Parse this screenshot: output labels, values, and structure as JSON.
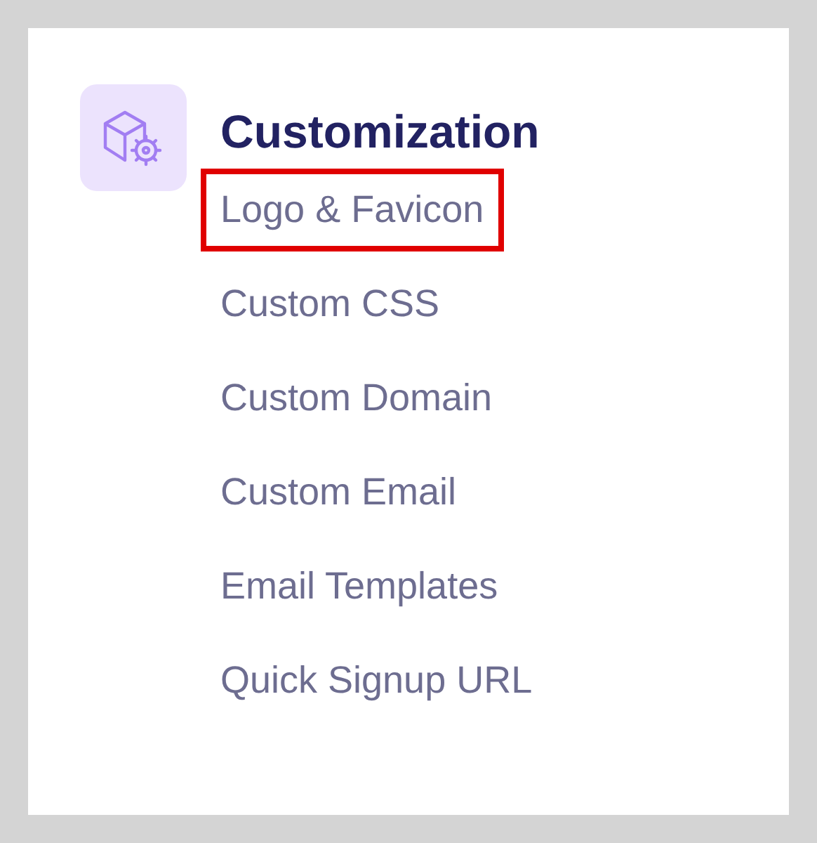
{
  "section": {
    "title": "Customization",
    "links": [
      {
        "label": "Logo & Favicon",
        "highlighted": true
      },
      {
        "label": "Custom CSS",
        "highlighted": false
      },
      {
        "label": "Custom Domain",
        "highlighted": false
      },
      {
        "label": "Custom Email",
        "highlighted": false
      },
      {
        "label": "Email Templates",
        "highlighted": false
      },
      {
        "label": "Quick Signup URL",
        "highlighted": false
      }
    ]
  }
}
